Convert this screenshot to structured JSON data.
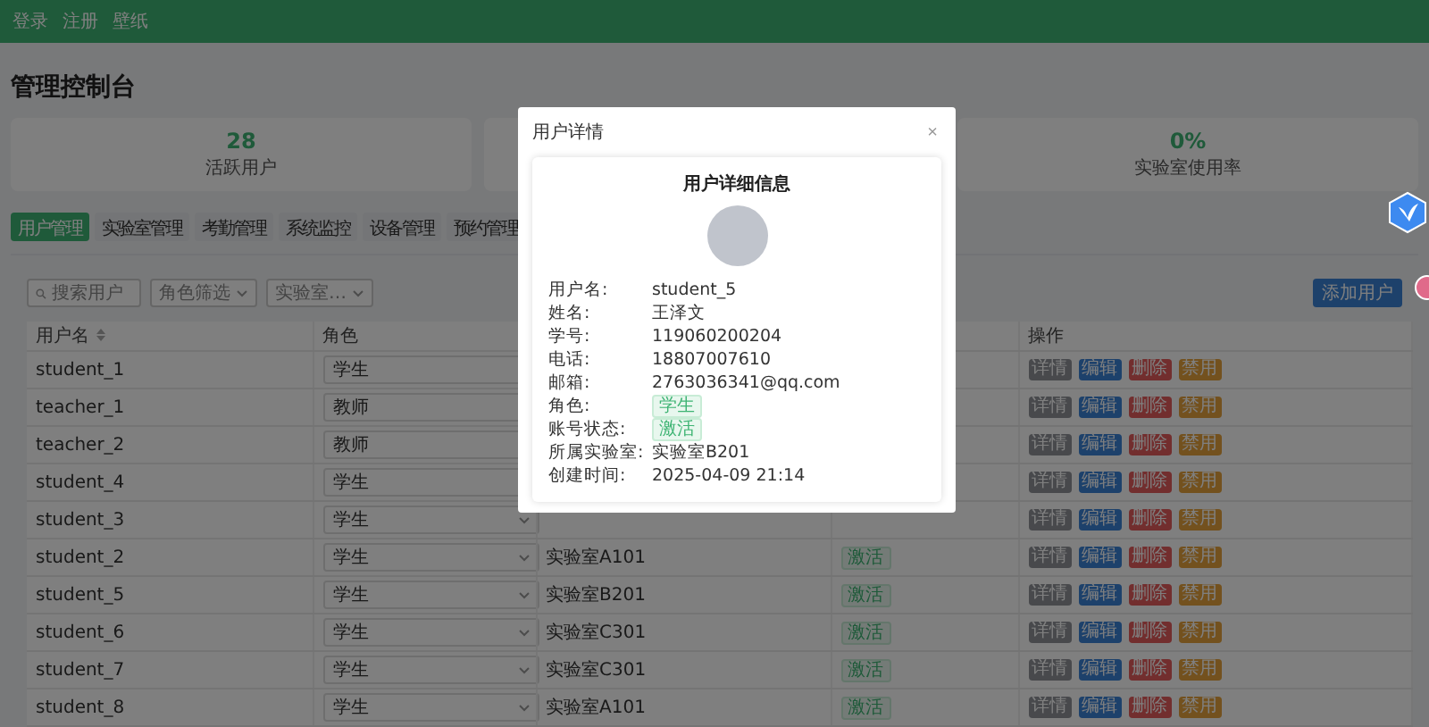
{
  "nav": {
    "links": [
      "登录",
      "注册",
      "壁纸"
    ]
  },
  "page_title": "管理控制台",
  "stats": [
    {
      "value": "28",
      "label": "活跃用户"
    },
    {
      "value": "0%",
      "label": "实验室使用率"
    }
  ],
  "tabs": [
    {
      "label": "用户管理",
      "selected": true
    },
    {
      "label": "实验室管理",
      "selected": false
    },
    {
      "label": "考勤管理",
      "selected": false
    },
    {
      "label": "系统监控",
      "selected": false
    },
    {
      "label": "设备管理",
      "selected": false
    },
    {
      "label": "预约管理",
      "selected": false
    }
  ],
  "filters": {
    "search": {
      "placeholder": "搜索用户"
    },
    "selects": [
      {
        "placeholder": "角色筛选"
      },
      {
        "placeholder": "实验室…"
      }
    ]
  },
  "add_button": "添加用户",
  "table": {
    "columns": [
      {
        "label": "用户名",
        "sortable": true
      },
      {
        "label": "角色",
        "sortable": false
      },
      {
        "label": "操作",
        "sortable": false
      }
    ],
    "rows": [
      {
        "username": "student_1",
        "role": "学生",
        "actions": [
          {
            "label": "详情",
            "kind": "info"
          },
          {
            "label": "编辑",
            "kind": "primary"
          },
          {
            "label": "删除",
            "kind": "danger"
          },
          {
            "label": "禁用",
            "kind": "warning"
          }
        ]
      },
      {
        "username": "teacher_1",
        "role": "教师",
        "actions": [
          {
            "label": "详情",
            "kind": "info"
          },
          {
            "label": "编辑",
            "kind": "primary"
          },
          {
            "label": "删除",
            "kind": "danger"
          },
          {
            "label": "禁用",
            "kind": "warning"
          }
        ]
      },
      {
        "username": "teacher_2",
        "role": "教师",
        "actions": [
          {
            "label": "详情",
            "kind": "info"
          },
          {
            "label": "编辑",
            "kind": "primary"
          },
          {
            "label": "删除",
            "kind": "danger"
          },
          {
            "label": "禁用",
            "kind": "warning"
          }
        ]
      },
      {
        "username": "student_4",
        "role": "学生",
        "actions": [
          {
            "label": "详情",
            "kind": "info"
          },
          {
            "label": "编辑",
            "kind": "primary"
          },
          {
            "label": "删除",
            "kind": "danger"
          },
          {
            "label": "禁用",
            "kind": "warning"
          }
        ]
      },
      {
        "username": "student_3",
        "role": "学生",
        "actions": [
          {
            "label": "详情",
            "kind": "info"
          },
          {
            "label": "编辑",
            "kind": "primary"
          },
          {
            "label": "删除",
            "kind": "danger"
          },
          {
            "label": "禁用",
            "kind": "warning"
          }
        ]
      },
      {
        "username": "student_2",
        "role": "学生",
        "lab": "实验室A101",
        "status": "激活",
        "actions": [
          {
            "label": "详情",
            "kind": "info"
          },
          {
            "label": "编辑",
            "kind": "primary"
          },
          {
            "label": "删除",
            "kind": "danger"
          },
          {
            "label": "禁用",
            "kind": "warning"
          }
        ]
      },
      {
        "username": "student_5",
        "role": "学生",
        "lab": "实验室B201",
        "status": "激活",
        "actions": [
          {
            "label": "详情",
            "kind": "info"
          },
          {
            "label": "编辑",
            "kind": "primary"
          },
          {
            "label": "删除",
            "kind": "danger"
          },
          {
            "label": "禁用",
            "kind": "warning"
          }
        ]
      },
      {
        "username": "student_6",
        "role": "学生",
        "lab": "实验室C301",
        "status": "激活",
        "actions": [
          {
            "label": "详情",
            "kind": "info"
          },
          {
            "label": "编辑",
            "kind": "primary"
          },
          {
            "label": "删除",
            "kind": "danger"
          },
          {
            "label": "禁用",
            "kind": "warning"
          }
        ]
      },
      {
        "username": "student_7",
        "role": "学生",
        "lab": "实验室C301",
        "status": "激活",
        "actions": [
          {
            "label": "详情",
            "kind": "info"
          },
          {
            "label": "编辑",
            "kind": "primary"
          },
          {
            "label": "删除",
            "kind": "danger"
          },
          {
            "label": "禁用",
            "kind": "warning"
          }
        ]
      },
      {
        "username": "student_8",
        "role": "学生",
        "lab": "实验室A101",
        "status": "激活",
        "actions": [
          {
            "label": "详情",
            "kind": "info"
          },
          {
            "label": "编辑",
            "kind": "primary"
          },
          {
            "label": "删除",
            "kind": "danger"
          },
          {
            "label": "禁用",
            "kind": "warning"
          }
        ]
      }
    ]
  },
  "dialog": {
    "title": "用户详情",
    "close": "×",
    "heading": "用户详细信息",
    "fields": [
      {
        "label": "用户名:",
        "value": "student_5",
        "kind": "text"
      },
      {
        "label": "姓名:",
        "value": "王泽文",
        "kind": "text"
      },
      {
        "label": "学号:",
        "value": "119060200204",
        "kind": "text"
      },
      {
        "label": "电话:",
        "value": "18807007610",
        "kind": "text"
      },
      {
        "label": "邮箱:",
        "value": "2763036341@qq.com",
        "kind": "text"
      },
      {
        "label": "角色:",
        "value": "学生",
        "kind": "tag"
      },
      {
        "label": "账号状态:",
        "value": "激活",
        "kind": "tag"
      },
      {
        "label": "所属实验室:",
        "value": "实验室B201",
        "kind": "text"
      },
      {
        "label": "创建时间:",
        "value": "2025-04-09 21:14",
        "kind": "text"
      }
    ]
  }
}
